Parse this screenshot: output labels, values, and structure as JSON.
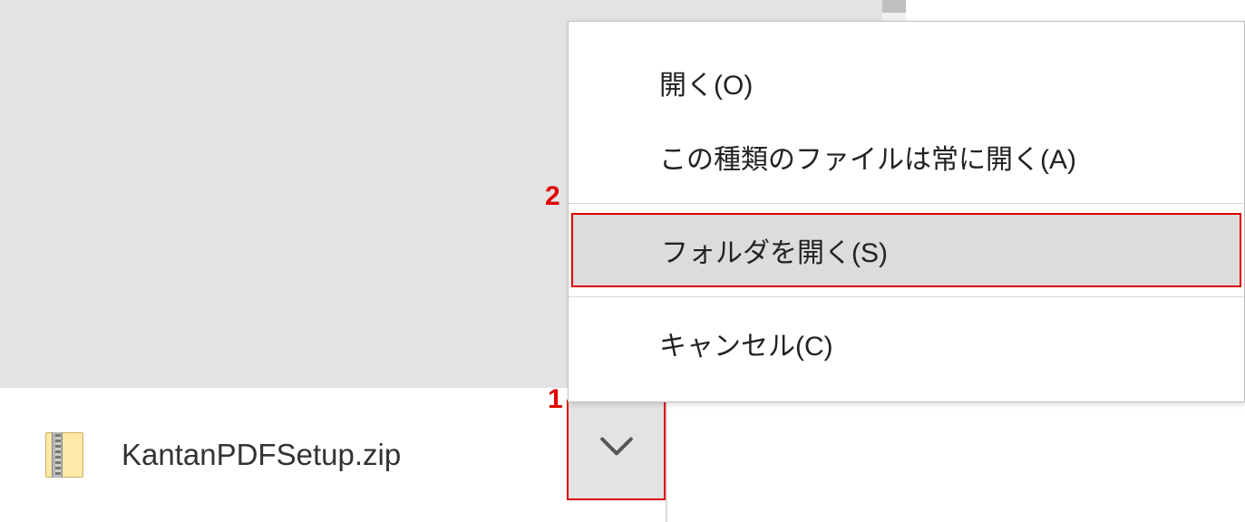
{
  "download": {
    "filename": "KantanPDFSetup.zip"
  },
  "menu": {
    "open": "開く(O)",
    "always_open": "この種類のファイルは常に開く(A)",
    "show_in_folder": "フォルダを開く(S)",
    "cancel": "キャンセル(C)"
  },
  "annotations": {
    "label1": "1",
    "label2": "2"
  }
}
